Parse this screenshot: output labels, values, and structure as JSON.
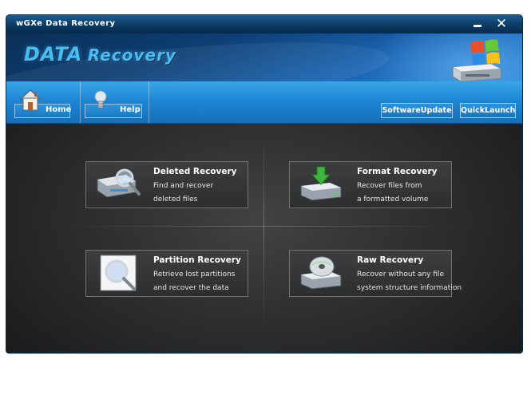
{
  "window": {
    "title": "wGXe Data Recovery"
  },
  "banner": {
    "logo_data": "DATA",
    "logo_recovery": "Recovery"
  },
  "toolbar": {
    "home_label": "Home",
    "help_label": "Help",
    "software_update_label": "SoftwareUpdate",
    "quick_launch_label": "QuickLaunch"
  },
  "cards": [
    {
      "title": "Deleted Recovery",
      "desc1": "Find and recover",
      "desc2": "deleted files",
      "icon": "magnifier-drive-icon"
    },
    {
      "title": "Format Recovery",
      "desc1": "Recover files from",
      "desc2": "a formatted volume",
      "icon": "drive-download-icon"
    },
    {
      "title": "Partition Recovery",
      "desc1": "Retrieve lost partitions",
      "desc2": "and recover the data",
      "icon": "magnifier-window-icon"
    },
    {
      "title": "Raw Recovery",
      "desc1": "Recover without any file",
      "desc2": "system structure information",
      "icon": "cd-drive-icon"
    }
  ]
}
